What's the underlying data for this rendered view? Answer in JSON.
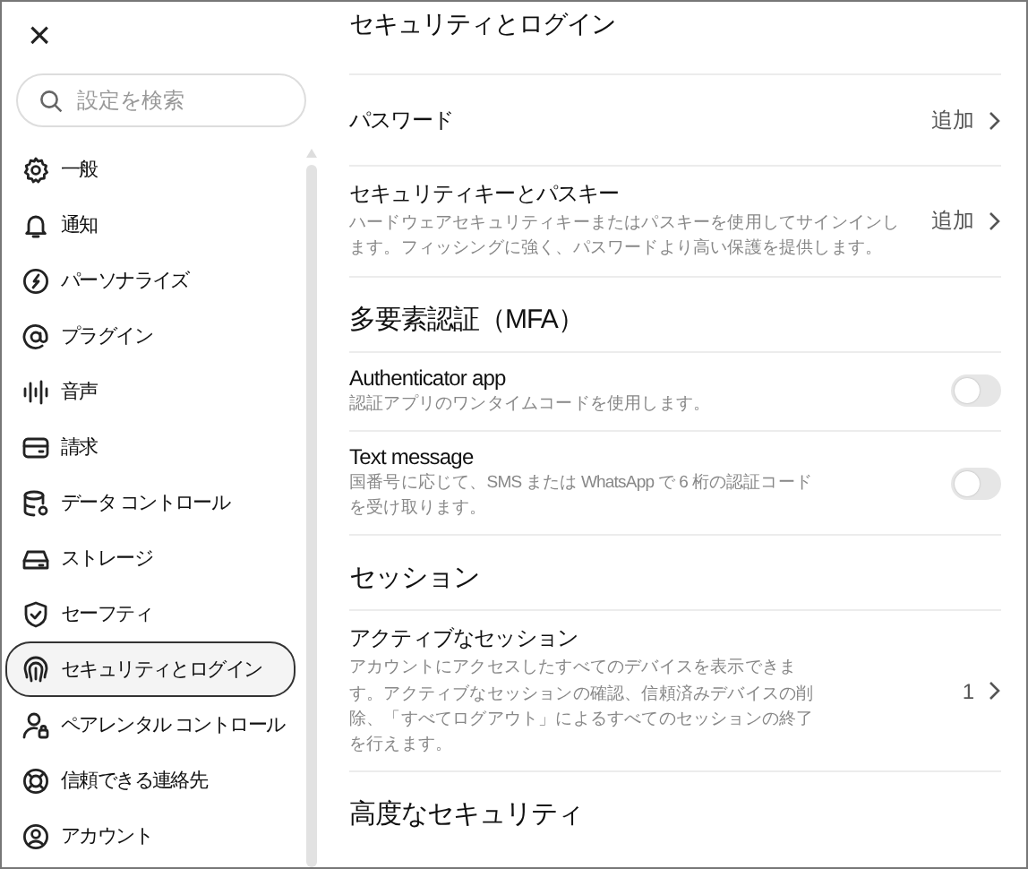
{
  "close_label": "×",
  "search": {
    "placeholder": "設定を検索"
  },
  "sidebar": {
    "items": [
      {
        "label": "一般",
        "selected": false
      },
      {
        "label": "通知",
        "selected": false
      },
      {
        "label": "パーソナライズ",
        "selected": false
      },
      {
        "label": "プラグイン",
        "selected": false
      },
      {
        "label": "音声",
        "selected": false
      },
      {
        "label": "請求",
        "selected": false
      },
      {
        "label": "データ コントロール",
        "selected": false
      },
      {
        "label": "ストレージ",
        "selected": false
      },
      {
        "label": "セーフティ",
        "selected": false
      },
      {
        "label": "セキュリティとログイン",
        "selected": true
      },
      {
        "label": "ペアレンタル コントロール",
        "selected": false
      },
      {
        "label": "信頼できる連絡先",
        "selected": false
      },
      {
        "label": "アカウント",
        "selected": false
      }
    ]
  },
  "page_title": "セキュリティとログイン",
  "sections": [
    {
      "rows": [
        {
          "kind": "link",
          "title": "パスワード",
          "value": "追加"
        },
        {
          "kind": "link",
          "title": "セキュリティキーとパスキー",
          "description": "ハードウェアセキュリティキーまたはパスキーを使用してサインインします。フィッシングに強く、パスワードより高い保護を提供します。",
          "value": "追加"
        }
      ]
    },
    {
      "heading": "多要素認証（MFA）",
      "rows": [
        {
          "kind": "toggle",
          "title": "Authenticator app",
          "description": "認証アプリのワンタイムコードを使用します。",
          "on": false
        },
        {
          "kind": "toggle",
          "title": "Text message",
          "description": "国番号に応じて、SMS または WhatsApp で 6 桁の認証コードを受け取ります。",
          "on": false
        }
      ]
    },
    {
      "heading": "セッション",
      "rows": [
        {
          "kind": "link",
          "title": "アクティブなセッション",
          "description": "アカウントにアクセスしたすべてのデバイスを表示できます。アクティブなセッションの確認、信頼済みデバイスの削除、「すべてログアウト」によるすべてのセッションの終了を行えます。",
          "value": "1"
        }
      ]
    },
    {
      "heading": "高度なセキュリティ"
    }
  ]
}
